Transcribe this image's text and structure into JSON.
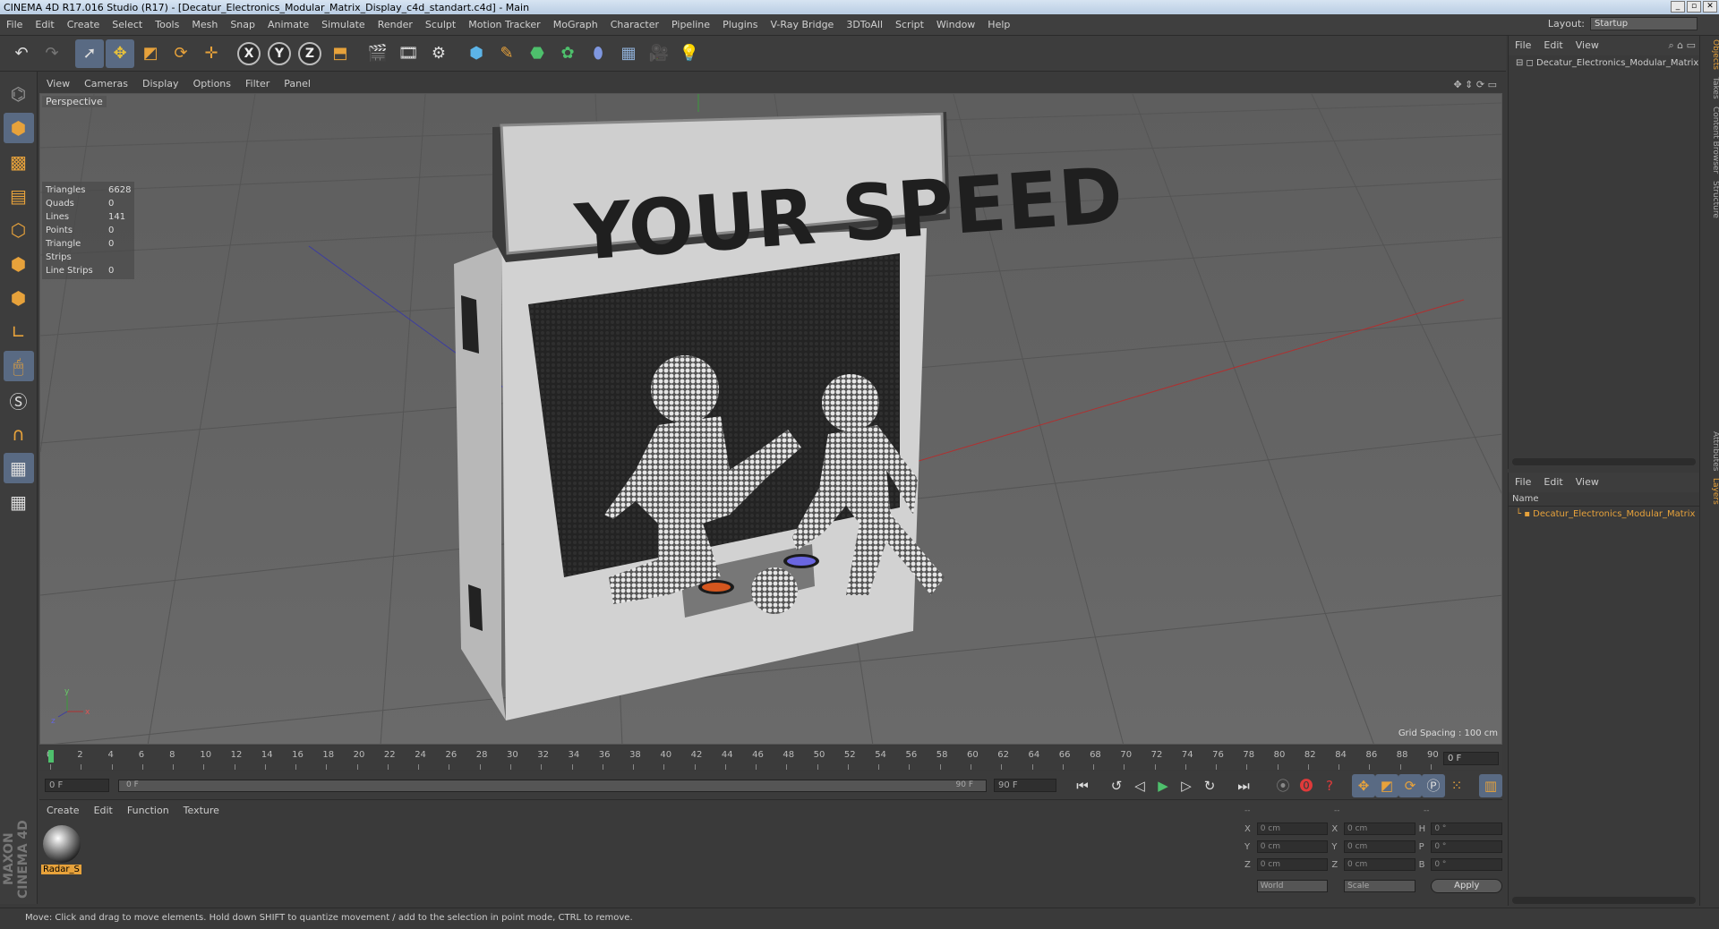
{
  "window": {
    "title": "CINEMA 4D R17.016 Studio (R17) - [Decatur_Electronics_Modular_Matrix_Display_c4d_standart.c4d] - Main",
    "min": "_",
    "max": "▫",
    "close": "✕"
  },
  "menubar": [
    "File",
    "Edit",
    "Create",
    "Select",
    "Tools",
    "Mesh",
    "Snap",
    "Animate",
    "Simulate",
    "Render",
    "Sculpt",
    "Motion Tracker",
    "MoGraph",
    "Character",
    "Pipeline",
    "Plugins",
    "V-Ray Bridge",
    "3DToAll",
    "Script",
    "Window",
    "Help"
  ],
  "layout": {
    "label": "Layout:",
    "value": "Startup"
  },
  "viewport": {
    "menu": [
      "View",
      "Cameras",
      "Display",
      "Options",
      "Filter",
      "Panel"
    ],
    "label": "Perspective",
    "stats": [
      {
        "k": "Triangles",
        "v": "6628"
      },
      {
        "k": "Quads",
        "v": "0"
      },
      {
        "k": "Lines",
        "v": "141"
      },
      {
        "k": "Points",
        "v": "0"
      },
      {
        "k": "Triangle Strips",
        "v": "0"
      },
      {
        "k": "Line Strips",
        "v": "0"
      }
    ],
    "sign_text": "YOUR SPEED",
    "grid_spacing": "Grid Spacing : 100 cm",
    "axis_labels": {
      "x": "x",
      "y": "y",
      "z": "z"
    }
  },
  "timeline": {
    "ticks": [
      "0",
      "2",
      "4",
      "6",
      "8",
      "10",
      "12",
      "14",
      "16",
      "18",
      "20",
      "22",
      "24",
      "26",
      "28",
      "30",
      "32",
      "34",
      "36",
      "38",
      "40",
      "42",
      "44",
      "46",
      "48",
      "50",
      "52",
      "54",
      "56",
      "58",
      "60",
      "62",
      "64",
      "66",
      "68",
      "70",
      "72",
      "74",
      "76",
      "78",
      "80",
      "82",
      "84",
      "86",
      "88",
      "90"
    ],
    "current_frame": "0 F",
    "start": "0 F",
    "range_start": "0 F",
    "range_end": "90 F",
    "end": "90 F"
  },
  "material_manager": {
    "menu": [
      "Create",
      "Edit",
      "Function",
      "Texture"
    ],
    "material_name": "Radar_S"
  },
  "coordinates": {
    "headers": [
      "--",
      "--",
      "--"
    ],
    "rows": [
      {
        "a": "X",
        "av": "0 cm",
        "b": "X",
        "bv": "0 cm",
        "c": "H",
        "cv": "0 °"
      },
      {
        "a": "Y",
        "av": "0 cm",
        "b": "Y",
        "bv": "0 cm",
        "c": "P",
        "cv": "0 °"
      },
      {
        "a": "Z",
        "av": "0 cm",
        "b": "Z",
        "bv": "0 cm",
        "c": "B",
        "cv": "0 °"
      }
    ],
    "space": "World",
    "mode": "Scale",
    "apply": "Apply"
  },
  "objects": {
    "menu": [
      "File",
      "Edit",
      "View"
    ],
    "items": [
      "Decatur_Electronics_Modular_Matrix"
    ]
  },
  "layers": {
    "menu": [
      "File",
      "Edit",
      "View"
    ],
    "header": "Name",
    "items": [
      "Decatur_Electronics_Modular_Matrix"
    ]
  },
  "side_tabs": [
    "Objects",
    "Takes",
    "Content Browser",
    "Structure"
  ],
  "side_tabs_lower": [
    "Attributes",
    "Layers"
  ],
  "statusbar": "Move: Click and drag to move elements. Hold down SHIFT to quantize movement / add to the selection in point mode, CTRL to remove.",
  "maxon": "MAXON CINEMA 4D",
  "colors": {
    "accent": "#e7a23b",
    "active": "#596a83"
  }
}
